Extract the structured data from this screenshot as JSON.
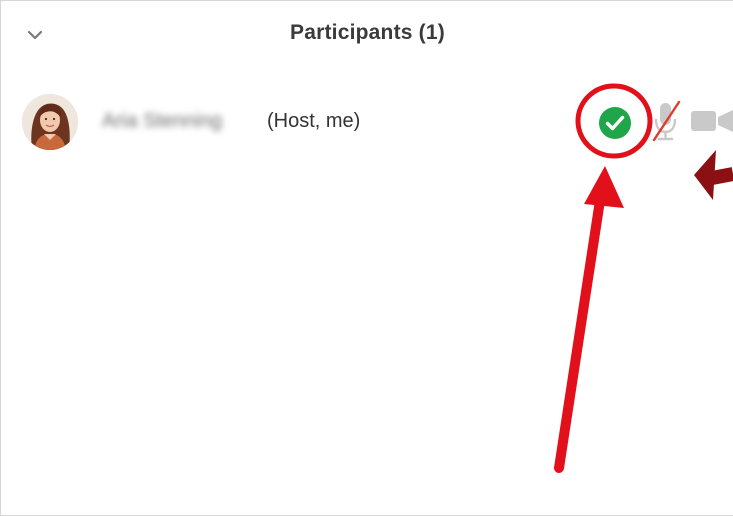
{
  "panel": {
    "title": "Participants (1)",
    "collapse_icon": "chevron-down-icon"
  },
  "participants": [
    {
      "name": "Aria Stenning",
      "role": "(Host, me)",
      "avatar_icon": "user-photo-avatar",
      "status_icon": "check-circle-icon",
      "status_color": "#1fa64a",
      "mic_icon": "microphone-muted-icon",
      "mic_muted": true,
      "video_icon": "video-camera-icon"
    }
  ],
  "annotations": {
    "highlight_color": "#e2101a",
    "arrow_color": "#e2101a",
    "secondary_arrow_color": "#8b1014"
  }
}
